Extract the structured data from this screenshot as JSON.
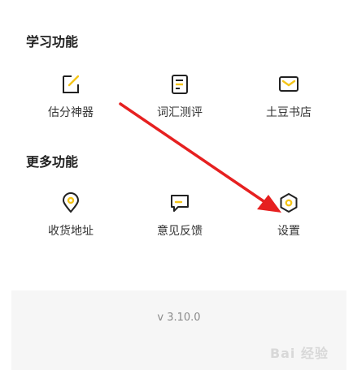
{
  "sections": [
    {
      "title": "学习功能",
      "items": [
        {
          "label": "估分神器",
          "icon": "edit-icon"
        },
        {
          "label": "词汇测评",
          "icon": "document-icon"
        },
        {
          "label": "土豆书店",
          "icon": "mail-icon"
        }
      ]
    },
    {
      "title": "更多功能",
      "items": [
        {
          "label": "收货地址",
          "icon": "location-pin-icon"
        },
        {
          "label": "意见反馈",
          "icon": "feedback-icon"
        },
        {
          "label": "设置",
          "icon": "settings-icon"
        }
      ]
    }
  ],
  "footer": {
    "version": "v 3.10.0",
    "watermark": "Bai 经验"
  },
  "colors": {
    "accent": "#f5c518",
    "icon_stroke": "#222222",
    "annotation_arrow": "#e62020"
  }
}
